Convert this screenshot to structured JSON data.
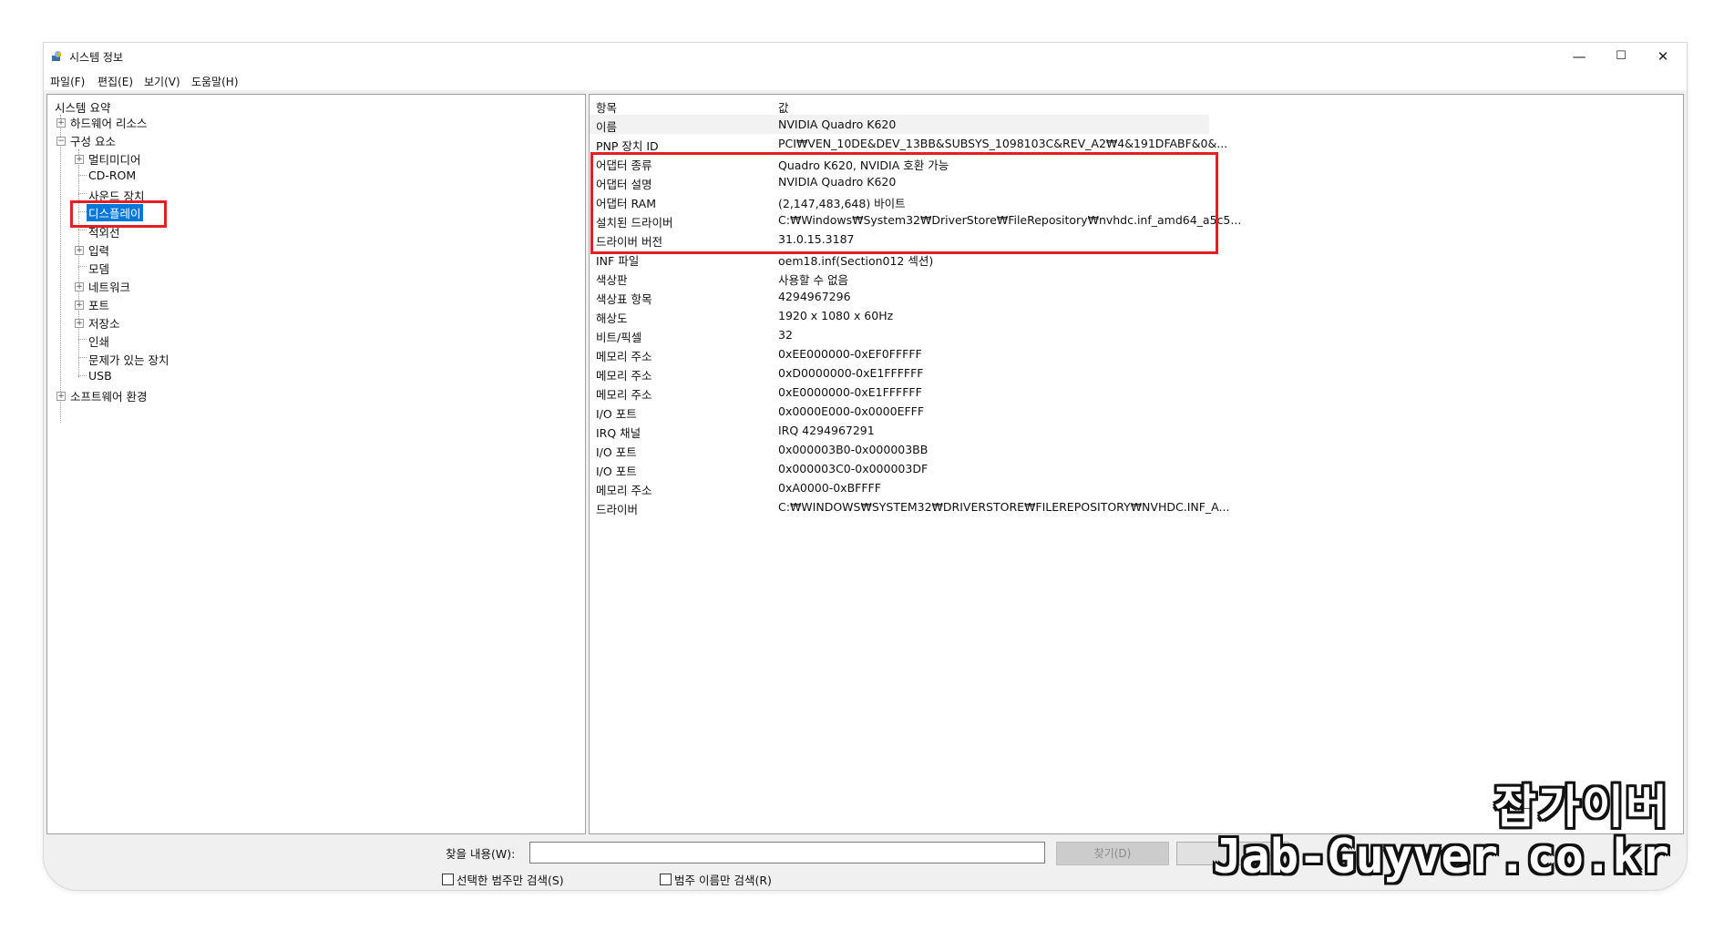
{
  "window": {
    "title": "시스템 정보",
    "icon": "system-info-icon",
    "controls": {
      "minimize": "—",
      "maximize": "☐",
      "close": "✕"
    }
  },
  "menu": [
    "파일(F)",
    "편집(E)",
    "보기(V)",
    "도움말(H)"
  ],
  "tree": {
    "root": "시스템 요약",
    "hardware": "하드웨어 리소스",
    "components": "구성 요소",
    "items": [
      "멀티미디어",
      "CD-ROM",
      "사운드 장치",
      "디스플레이",
      "적외선",
      "입력",
      "모뎀",
      "네트워크",
      "포트",
      "저장소",
      "인쇄",
      "문제가 있는 장치",
      "USB"
    ],
    "software": "소프트웨어 환경",
    "selected": "디스플레이"
  },
  "details": {
    "headers": {
      "item": "항목",
      "value": "값"
    },
    "rows": [
      {
        "item": "이름",
        "value": "NVIDIA Quadro K620"
      },
      {
        "item": "PNP 장치 ID",
        "value": "PCI₩VEN_10DE&DEV_13BB&SUBSYS_1098103C&REV_A2₩4&191DFABF&0&..."
      },
      {
        "item": "어댑터 종류",
        "value": "Quadro K620, NVIDIA 호환 가능"
      },
      {
        "item": "어댑터 설명",
        "value": "NVIDIA Quadro K620"
      },
      {
        "item": "어댑터 RAM",
        "value": "(2,147,483,648) 바이트"
      },
      {
        "item": "설치된 드라이버",
        "value": "C:₩Windows₩System32₩DriverStore₩FileRepository₩nvhdc.inf_amd64_a5c5..."
      },
      {
        "item": "드라이버 버전",
        "value": "31.0.15.3187"
      },
      {
        "item": "INF 파일",
        "value": "oem18.inf(Section012 섹션)"
      },
      {
        "item": "색상판",
        "value": "사용할 수 없음"
      },
      {
        "item": "색상표 항목",
        "value": "4294967296"
      },
      {
        "item": "해상도",
        "value": "1920 x 1080 x 60Hz"
      },
      {
        "item": "비트/픽셀",
        "value": "32"
      },
      {
        "item": "메모리 주소",
        "value": "0xEE000000-0xEF0FFFFF"
      },
      {
        "item": "메모리 주소",
        "value": "0xD0000000-0xE1FFFFFF"
      },
      {
        "item": "메모리 주소",
        "value": "0xE0000000-0xE1FFFFFF"
      },
      {
        "item": "I/O 포트",
        "value": "0x0000E000-0x0000EFFF"
      },
      {
        "item": "IRQ 채널",
        "value": "IRQ 4294967291"
      },
      {
        "item": "I/O 포트",
        "value": "0x000003B0-0x000003BB"
      },
      {
        "item": "I/O 포트",
        "value": "0x000003C0-0x000003DF"
      },
      {
        "item": "메모리 주소",
        "value": "0xA0000-0xBFFFF"
      },
      {
        "item": "드라이버",
        "value": "C:₩WINDOWS₩SYSTEM32₩DRIVERSTORE₩FILEREPOSITORY₩NVHDC.INF_A..."
      }
    ]
  },
  "find": {
    "label": "찾을 내용(W):",
    "input_value": "",
    "find_button": "찾기(D)",
    "close_button": "",
    "check_category": "선택한 범주만 검색(S)",
    "check_names": "범주 이름만 검색(R)"
  },
  "watermark": {
    "korean": "잡가이버",
    "english": "Jab-Guyver.co.kr"
  },
  "colors": {
    "highlight": "#e31e24",
    "selection": "#0078d7"
  }
}
